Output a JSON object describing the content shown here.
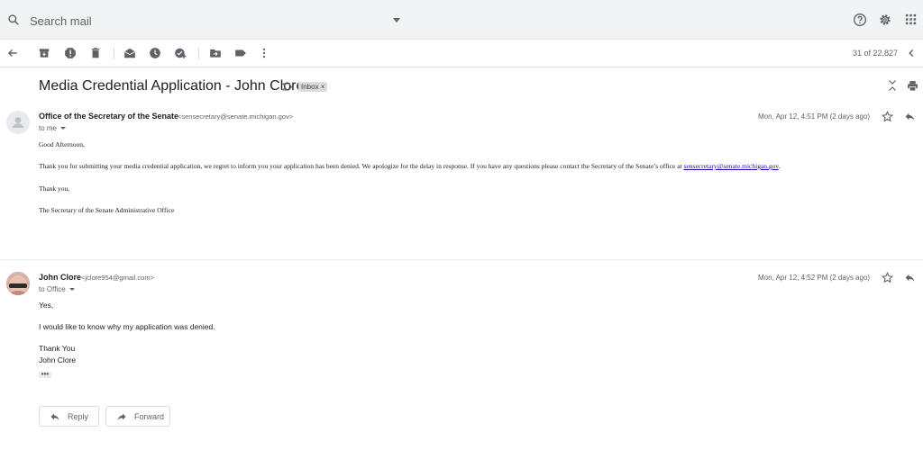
{
  "search": {
    "placeholder": "Search mail"
  },
  "toolbar": {
    "pager": "31 of 22,827"
  },
  "subject": "Media Credential Application - John Clore",
  "label": "Inbox ×",
  "messages": [
    {
      "sender": "Office of the Secretary of the Senate",
      "email": "<sensecretary@senate.michigan.gov>",
      "to": "to me",
      "date": "Mon, Apr 12, 4:51 PM (2 days ago)",
      "greeting": "Good Afternoon,",
      "body_pre": "Thank you for submitting your media credential application, we regret to inform you your application has been denied. We apologize for the delay in response. If you have any questions please contact the Secretary of the Senate’s office at ",
      "body_link": "sensecretary@senate.michigan.gov",
      "body_post": ".",
      "closing": "Thank you,",
      "signature": "The Secretary of the Senate Administrative Office"
    },
    {
      "sender": "John Clore",
      "email": "<jclore954@gmail.com>",
      "to": "to Office",
      "date": "Mon, Apr 12, 4:52 PM (2 days ago)",
      "line1": "Yes,",
      "line2": "I would like to know why my application was denied.",
      "line3": "Thank You",
      "line4": "John Clore",
      "ellipsis": "•••"
    }
  ],
  "actions": {
    "reply": "Reply",
    "forward": "Forward"
  },
  "colors": {
    "link": "#1a0dab",
    "icon": "#5f6368",
    "topbar": "#f1f3f4"
  }
}
